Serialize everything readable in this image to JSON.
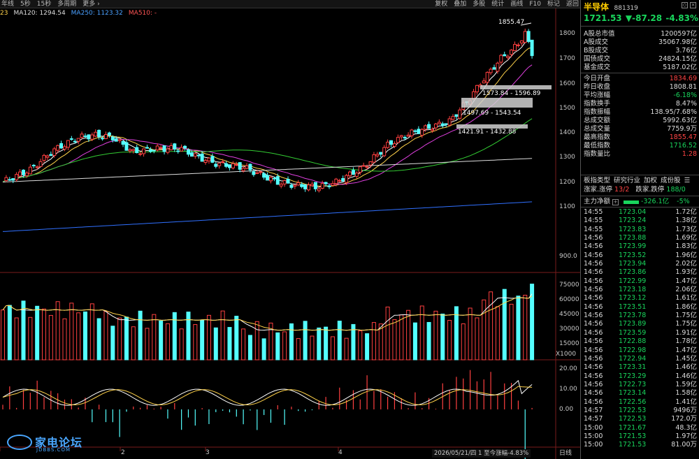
{
  "toolbar": {
    "periods": [
      "年线",
      "5秒",
      "15秒",
      "多周期",
      "更多 ›"
    ],
    "tools": [
      "复权",
      "叠加",
      "多股",
      "统计",
      "画线",
      "F10",
      "标记",
      "返回"
    ]
  },
  "ma_legend": {
    "partial": "23",
    "ma120": "MA120: 1294.54",
    "ma250": "MA250: 1123.32",
    "ma510": "MA510: -"
  },
  "y_axis": {
    "price": [
      "1800",
      "1700",
      "1600",
      "1500",
      "1400",
      "1300",
      "1200",
      "1100",
      "900.0"
    ],
    "volume": [
      "75000",
      "60000",
      "45000",
      "30000",
      "15000",
      "X1000"
    ],
    "indicator": [
      "20.00",
      "10.00",
      "0.00"
    ]
  },
  "x_axis": [
    "2",
    "3",
    "4"
  ],
  "annotations": {
    "high": "1855.47",
    "zone1": "1573.84 - 1596.89",
    "zone2": "1497.69 - 1543.54",
    "zone3": "1421.91 - 1432.88"
  },
  "status": "2026/05/21/四 1 至今涨幅-4.83%",
  "bottom_right": "日线",
  "logo": {
    "text": "家电论坛",
    "sub": "JDBBS.COM"
  },
  "panel": {
    "name": "半导体",
    "code": "881319",
    "price": "1721.53",
    "change": "▼-87.28",
    "pct": "-4.83%",
    "stats": [
      {
        "k": "A股总市值",
        "v": "1200597亿",
        "c": ""
      },
      {
        "k": "A股成交",
        "v": "35067.98亿",
        "c": ""
      },
      {
        "k": "B股成交",
        "v": "3.76亿",
        "c": ""
      },
      {
        "k": "国债成交",
        "v": "24824.15亿",
        "c": ""
      },
      {
        "k": "基金成交",
        "v": "5187.02亿",
        "c": ""
      },
      {
        "k": "今日开盘",
        "v": "1834.69",
        "c": "red"
      },
      {
        "k": "昨日收盘",
        "v": "1808.81",
        "c": ""
      },
      {
        "k": "平均涨幅",
        "v": "-6.18%",
        "c": "green"
      },
      {
        "k": "指数换手",
        "v": "8.47%",
        "c": ""
      },
      {
        "k": "指数振幅",
        "v": "138.95/7.68%",
        "c": ""
      },
      {
        "k": "总成交额",
        "v": "5992.63亿",
        "c": ""
      },
      {
        "k": "总成交量",
        "v": "7759.9万",
        "c": ""
      },
      {
        "k": "最高指数",
        "v": "1855.47",
        "c": "red"
      },
      {
        "k": "最低指数",
        "v": "1716.52",
        "c": "green"
      },
      {
        "k": "指数量比",
        "v": "1.28",
        "c": "red"
      }
    ],
    "sector": [
      "板指类型",
      "研究行业",
      "加权",
      "成份股",
      "☰"
    ],
    "rise": {
      "label1": "涨家.涨停",
      "val1": "13/2",
      "label2": "跌家.跌停",
      "val2": "188/0"
    },
    "flow": {
      "label": "主力净额",
      "value": "-326.1亿",
      "pct": "-5%"
    },
    "ticks": [
      {
        "t": "14:55",
        "p": "1723.04",
        "v": "1.72亿"
      },
      {
        "t": "14:55",
        "p": "1723.24",
        "v": "1.38亿"
      },
      {
        "t": "14:55",
        "p": "1723.83",
        "v": "1.73亿"
      },
      {
        "t": "14:56",
        "p": "1723.88",
        "v": "1.69亿"
      },
      {
        "t": "14:56",
        "p": "1723.99",
        "v": "1.83亿"
      },
      {
        "t": "14:56",
        "p": "1723.52",
        "v": "1.96亿"
      },
      {
        "t": "14:56",
        "p": "1723.94",
        "v": "2.02亿"
      },
      {
        "t": "14:56",
        "p": "1723.86",
        "v": "1.93亿"
      },
      {
        "t": "14:56",
        "p": "1722.99",
        "v": "1.47亿"
      },
      {
        "t": "14:56",
        "p": "1723.18",
        "v": "2.06亿"
      },
      {
        "t": "14:56",
        "p": "1723.12",
        "v": "1.61亿"
      },
      {
        "t": "14:56",
        "p": "1723.51",
        "v": "1.86亿"
      },
      {
        "t": "14:56",
        "p": "1723.78",
        "v": "1.75亿"
      },
      {
        "t": "14:56",
        "p": "1723.89",
        "v": "1.75亿"
      },
      {
        "t": "14:56",
        "p": "1723.59",
        "v": "1.91亿"
      },
      {
        "t": "14:56",
        "p": "1722.88",
        "v": "1.78亿"
      },
      {
        "t": "14:56",
        "p": "1722.98",
        "v": "1.47亿"
      },
      {
        "t": "14:56",
        "p": "1722.94",
        "v": "1.45亿"
      },
      {
        "t": "14:56",
        "p": "1723.31",
        "v": "1.46亿"
      },
      {
        "t": "14:56",
        "p": "1723.29",
        "v": "1.46亿"
      },
      {
        "t": "14:56",
        "p": "1722.73",
        "v": "1.59亿"
      },
      {
        "t": "14:56",
        "p": "1723.14",
        "v": "1.58亿"
      },
      {
        "t": "14:56",
        "p": "1722.56",
        "v": "1.41亿"
      },
      {
        "t": "14:57",
        "p": "1722.53",
        "v": "9496万"
      },
      {
        "t": "14:57",
        "p": "1722.53",
        "v": "172.0万"
      },
      {
        "t": "15:00",
        "p": "1721.67",
        "v": "48.3亿"
      },
      {
        "t": "15:00",
        "p": "1721.53",
        "v": "1.97亿"
      },
      {
        "t": "15:00",
        "p": "1721.53",
        "v": "81.00万"
      }
    ]
  }
}
